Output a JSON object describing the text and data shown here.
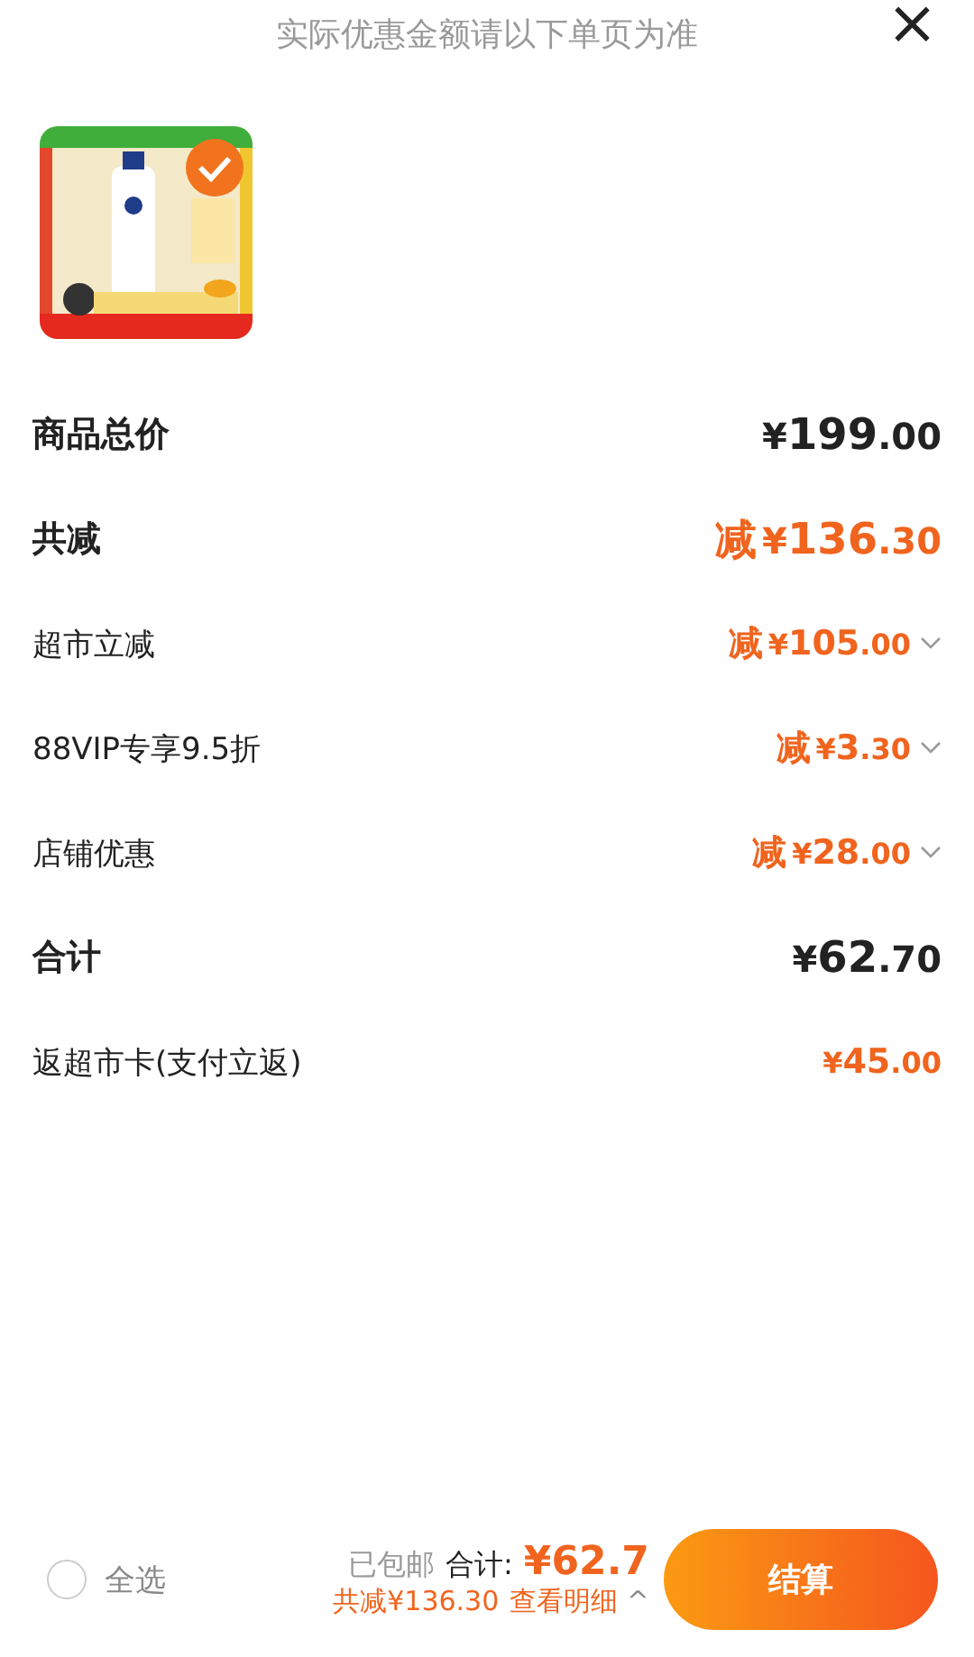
{
  "header": {
    "notice": "实际优惠金额请以下单页为准",
    "close": "×"
  },
  "product": {
    "selected": true
  },
  "rows": [
    {
      "label": "商品总价",
      "bold": true,
      "color": "#222222",
      "expandable": false,
      "prefix": "",
      "currency": "¥",
      "integer": "199",
      "decimals": ".00"
    },
    {
      "label": "共减",
      "bold": true,
      "color": "#f0641e",
      "expandable": false,
      "prefix": "减",
      "currency": "¥",
      "integer": "136",
      "decimals": ".30"
    },
    {
      "label": "超市立减",
      "bold": false,
      "color": "#f0641e",
      "expandable": true,
      "prefix": "减",
      "currency": "¥",
      "integer": "105",
      "decimals": ".00"
    },
    {
      "label": "88VIP专享9.5折",
      "bold": false,
      "color": "#f0641e",
      "expandable": true,
      "prefix": "减",
      "currency": "¥",
      "integer": "3",
      "decimals": ".30"
    },
    {
      "label": "店铺优惠",
      "bold": false,
      "color": "#f0641e",
      "expandable": true,
      "prefix": "减",
      "currency": "¥",
      "integer": "28",
      "decimals": ".00"
    },
    {
      "label": "合计",
      "bold": true,
      "color": "#222222",
      "expandable": false,
      "prefix": "",
      "currency": "¥",
      "integer": "62",
      "decimals": ".70"
    },
    {
      "label": "返超市卡(支付立返)",
      "bold": false,
      "color": "#f0641e",
      "expandable": false,
      "prefix": "",
      "currency": "¥",
      "integer": "45",
      "decimals": ".00"
    }
  ],
  "footer": {
    "select_all": {
      "label": "全选",
      "checked": false
    },
    "shipping": "已包邮",
    "total_label": "合计:",
    "total": "¥62.7",
    "saved": "共减¥136.30",
    "details": "查看明细",
    "details_caret": "^",
    "checkout": "结算"
  }
}
